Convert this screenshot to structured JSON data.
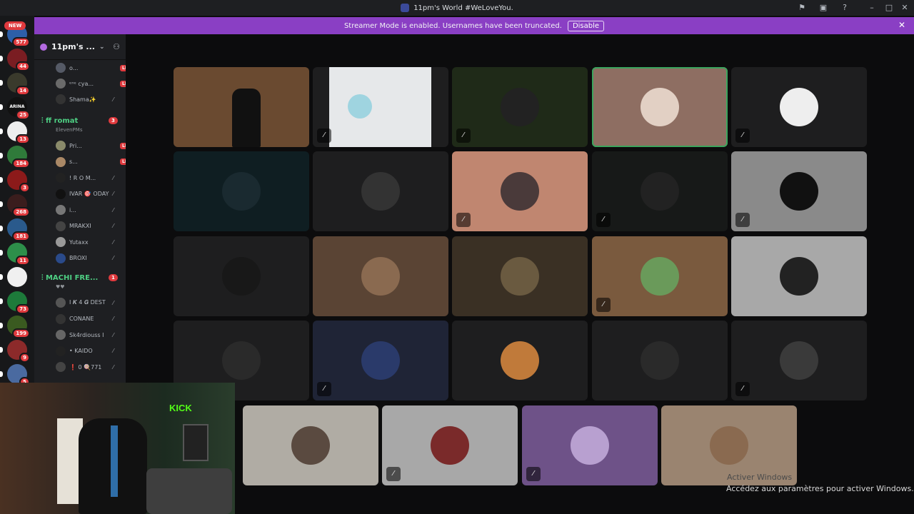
{
  "window": {
    "title": "11pm's World #WeLoveYou."
  },
  "banner": {
    "text": "Streamer Mode is enabled. Usernames have been truncated.",
    "button": "Disable"
  },
  "servers": {
    "new_badge": "NEW",
    "items": [
      {
        "badge": "577",
        "color": "#2d5fa8"
      },
      {
        "badge": "44",
        "color": "#7a1d22"
      },
      {
        "badge": "14",
        "color": "#3a3a2c"
      },
      {
        "badge": "25",
        "color": "#111111",
        "label": "ARINA"
      },
      {
        "badge": "13",
        "color": "#eeeeee"
      },
      {
        "badge": "184",
        "color": "#2f7a3a"
      },
      {
        "badge": "3",
        "color": "#8c1a1a"
      },
      {
        "badge": "268",
        "color": "#3a1d1d"
      },
      {
        "badge": "181",
        "color": "#2a5a8c"
      },
      {
        "badge": "11",
        "color": "#2d8f4a"
      },
      {
        "badge": "",
        "color": "#f0f0f0"
      },
      {
        "badge": "73",
        "color": "#1d7a3a"
      },
      {
        "badge": "199",
        "color": "#3a5a20"
      },
      {
        "badge": "9",
        "color": "#8c2a2a"
      },
      {
        "badge": "5",
        "color": "#4a6aa0"
      }
    ]
  },
  "sidebar": {
    "guild_name": "11pm's ...",
    "channels": [
      {
        "name": "ff romat",
        "count": "3",
        "sub": "ElevenPMs"
      },
      {
        "name": "MACHI FRE...",
        "count": "1",
        "sub": "♥♥"
      }
    ],
    "users_top": [
      {
        "name": "o...",
        "live": "LIVE",
        "color": "#555a66"
      },
      {
        "name": "ᵉⁿᵉ cya...",
        "live": "LIVE",
        "color": "#6a6a6a"
      },
      {
        "name": "Shama✨",
        "live": "",
        "color": "#333"
      }
    ],
    "users_ch1": [
      {
        "name": "Pri...",
        "live": "LIVE",
        "color": "#8a8a6a"
      },
      {
        "name": "s...",
        "live": "LIVE",
        "color": "#aa8866"
      },
      {
        "name": "! R O M...",
        "live": "",
        "color": "#222"
      },
      {
        "name": "IVAR 🎯 ODAY",
        "live": "",
        "color": "#111"
      },
      {
        "name": "i...",
        "live": "",
        "color": "#777"
      },
      {
        "name": "MRAKXI",
        "live": "",
        "color": "#444"
      },
      {
        "name": "Yutaxx",
        "live": "",
        "color": "#999"
      },
      {
        "name": "BROXI",
        "live": "",
        "color": "#2a4a8a"
      }
    ],
    "users_ch2": [
      {
        "name": "I 𝑲 4 𝑮 DEST",
        "live": "",
        "color": "#555"
      },
      {
        "name": "CONANE",
        "live": "",
        "color": "#333"
      },
      {
        "name": "Sk4rdiouss I",
        "live": "",
        "color": "#666"
      },
      {
        "name": "• KAIDO",
        "live": "",
        "color": "#222"
      },
      {
        "name": "❗ 0 🍭771",
        "live": "",
        "color": "#444"
      }
    ]
  },
  "tiles": [
    {
      "bg": "#6a4a30",
      "av": "#222",
      "mute": false,
      "screen": true
    },
    {
      "bg": "#1e1e1f",
      "av": "#d8e8ee",
      "mute": true,
      "screen": true
    },
    {
      "bg": "#1f2a18",
      "av": "#222",
      "mute": true
    },
    {
      "bg": "#8e6e62",
      "av": "#e2d0c4",
      "mute": false,
      "speaking": true
    },
    {
      "bg": "#1e1e1f",
      "av": "#eeeeee",
      "mute": true
    },
    {
      "bg": "#0f1e22",
      "av": "#1a2a30",
      "mute": false
    },
    {
      "bg": "#1e1e1f",
      "av": "#333",
      "mute": false
    },
    {
      "bg": "#c08670",
      "av": "#4a3a3a",
      "mute": true
    },
    {
      "bg": "#171918",
      "av": "#222",
      "mute": true
    },
    {
      "bg": "#8a8a8a",
      "av": "#111",
      "mute": true
    },
    {
      "bg": "#1e1e1f",
      "av": "#181818",
      "mute": false
    },
    {
      "bg": "#5a4434",
      "av": "#8a6a50",
      "mute": false
    },
    {
      "bg": "#3a3024",
      "av": "#6a5a40",
      "mute": false
    },
    {
      "bg": "#7a5a3e",
      "av": "#6a9a5a",
      "mute": true
    },
    {
      "bg": "#a8a8a8",
      "av": "#222",
      "mute": false
    },
    {
      "bg": "#1e1e1f",
      "av": "#2a2a2a",
      "mute": false
    },
    {
      "bg": "#1f2436",
      "av": "#2a3a6a",
      "mute": true
    },
    {
      "bg": "#1e1e1f",
      "av": "#c07a3a",
      "mute": false
    },
    {
      "bg": "#1e1e1f",
      "av": "#2a2a2a",
      "mute": false
    },
    {
      "bg": "#1e1e1f",
      "av": "#3a3a3a",
      "mute": true
    },
    {
      "bg": "#b0aca4",
      "av": "#5a4a40",
      "mute": false
    },
    {
      "bg": "#a8a8a8",
      "av": "#7a2a2a",
      "mute": true
    },
    {
      "bg": "#6e5288",
      "av": "#b8a0d0",
      "mute": true
    },
    {
      "bg": "#9a8470",
      "av": "#8a6a50",
      "mute": false
    }
  ],
  "webcam": {
    "sign": "KICK"
  },
  "activation": {
    "line1": "Activer Windows",
    "line2": "Accédez aux paramètres pour activer Windows."
  },
  "icons": {
    "mute": "🎙",
    "close": "✕"
  }
}
